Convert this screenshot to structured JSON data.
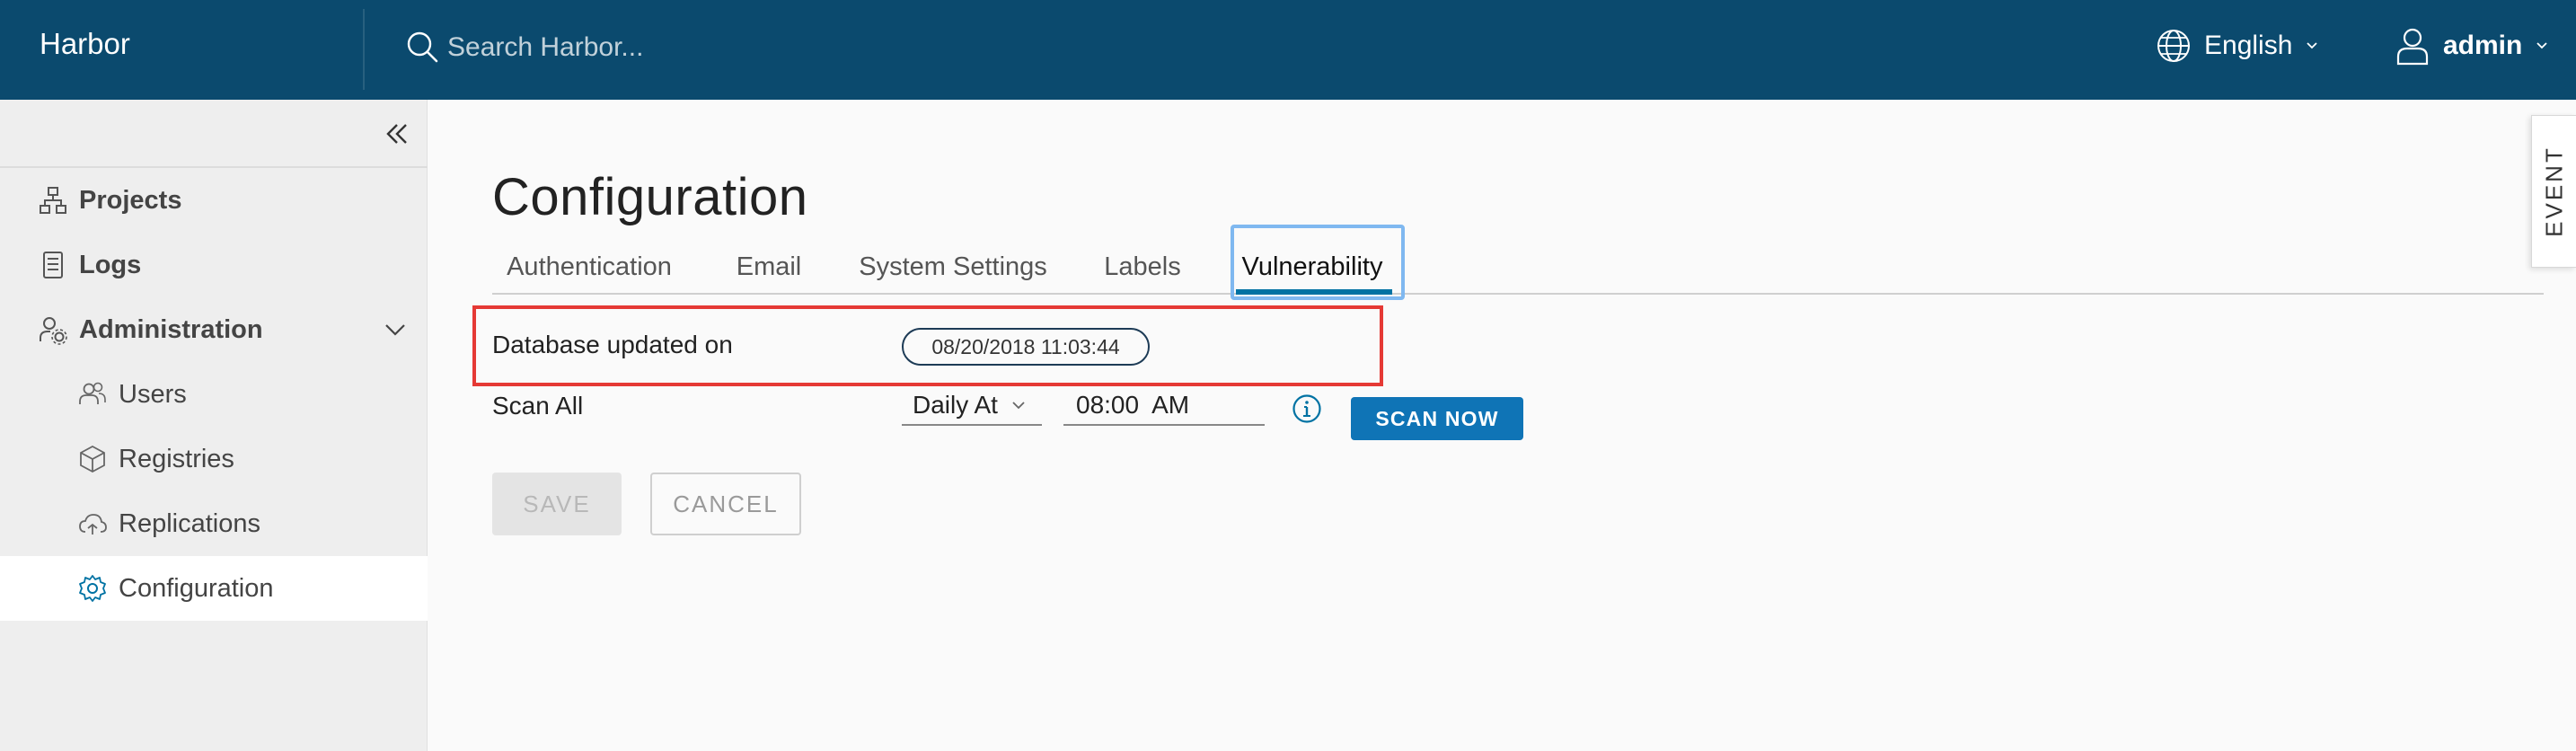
{
  "colors": {
    "brand": "#0b4a6e",
    "accent": "#0072a3",
    "highlight": "#e53935"
  },
  "header": {
    "brand": "Harbor",
    "search_placeholder": "Search Harbor...",
    "language": "English",
    "user": "admin"
  },
  "sidebar": {
    "items": [
      {
        "label": "Projects",
        "icon": "projects-icon"
      },
      {
        "label": "Logs",
        "icon": "logs-icon"
      },
      {
        "label": "Administration",
        "icon": "administration-icon"
      },
      {
        "label": "Users",
        "icon": "users-icon"
      },
      {
        "label": "Registries",
        "icon": "registries-icon"
      },
      {
        "label": "Replications",
        "icon": "replications-icon"
      },
      {
        "label": "Configuration",
        "icon": "gear-icon",
        "active": true
      }
    ]
  },
  "page": {
    "title": "Configuration",
    "tabs": [
      "Authentication",
      "Email",
      "System Settings",
      "Labels",
      "Vulnerability"
    ],
    "active_tab": "Vulnerability"
  },
  "vulnerability": {
    "db_label": "Database updated on",
    "db_timestamp": "08/20/2018 11:03:44",
    "scan_all_label": "Scan All",
    "schedule_value": "Daily At",
    "time_value": "08:00  AM",
    "scan_now_label": "SCAN NOW"
  },
  "actions": {
    "save_label": "SAVE",
    "cancel_label": "CANCEL"
  },
  "event_tab": "EVENT"
}
